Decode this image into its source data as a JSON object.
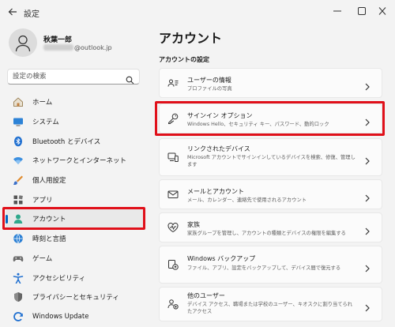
{
  "window": {
    "title": "設定"
  },
  "user": {
    "name": "秋葉一郎",
    "email_suffix": "@outlook.jp"
  },
  "search": {
    "placeholder": "設定の検索"
  },
  "nav": {
    "items": [
      {
        "label": "ホーム",
        "icon": "home-icon"
      },
      {
        "label": "システム",
        "icon": "system-icon"
      },
      {
        "label": "Bluetooth とデバイス",
        "icon": "bluetooth-icon"
      },
      {
        "label": "ネットワークとインターネット",
        "icon": "network-icon"
      },
      {
        "label": "個人用設定",
        "icon": "personalization-icon"
      },
      {
        "label": "アプリ",
        "icon": "apps-icon"
      },
      {
        "label": "アカウント",
        "icon": "account-icon",
        "active": true
      },
      {
        "label": "時刻と言語",
        "icon": "time-language-icon"
      },
      {
        "label": "ゲーム",
        "icon": "gaming-icon"
      },
      {
        "label": "アクセシビリティ",
        "icon": "accessibility-icon"
      },
      {
        "label": "プライバシーとセキュリティ",
        "icon": "privacy-icon"
      },
      {
        "label": "Windows Update",
        "icon": "update-icon"
      }
    ]
  },
  "main": {
    "title": "アカウント",
    "section": "アカウントの設定",
    "cards": [
      {
        "title": "ユーザーの情報",
        "desc": "プロファイルの写真",
        "icon": "user-info-icon"
      },
      {
        "title": "サインイン オプション",
        "desc": "Windows Hello、セキュリティ キー、パスワード、動的ロック",
        "icon": "key-icon"
      },
      {
        "title": "リンクされたデバイス",
        "desc": "Microsoft アカウントでサインインしているデバイスを検索、修復、管理します",
        "icon": "linked-devices-icon"
      },
      {
        "title": "メールとアカウント",
        "desc": "メール、カレンダー、連絡先で使用されるアカウント",
        "icon": "mail-icon"
      },
      {
        "title": "家族",
        "desc": "家族グループを管理し、アカウントの種類とデバイスの権限を編集する",
        "icon": "family-icon"
      },
      {
        "title": "Windows バックアップ",
        "desc": "ファイル、アプリ、設定をバックアップして、デバイス間で復元する",
        "icon": "backup-icon"
      },
      {
        "title": "他のユーザー",
        "desc": "デバイス アクセス、職場または学校のユーザー、キオスクに割り当てられたアクセス",
        "icon": "other-users-icon"
      }
    ]
  },
  "colors": {
    "accent": "#0067c0",
    "highlight": "#e0101a"
  }
}
